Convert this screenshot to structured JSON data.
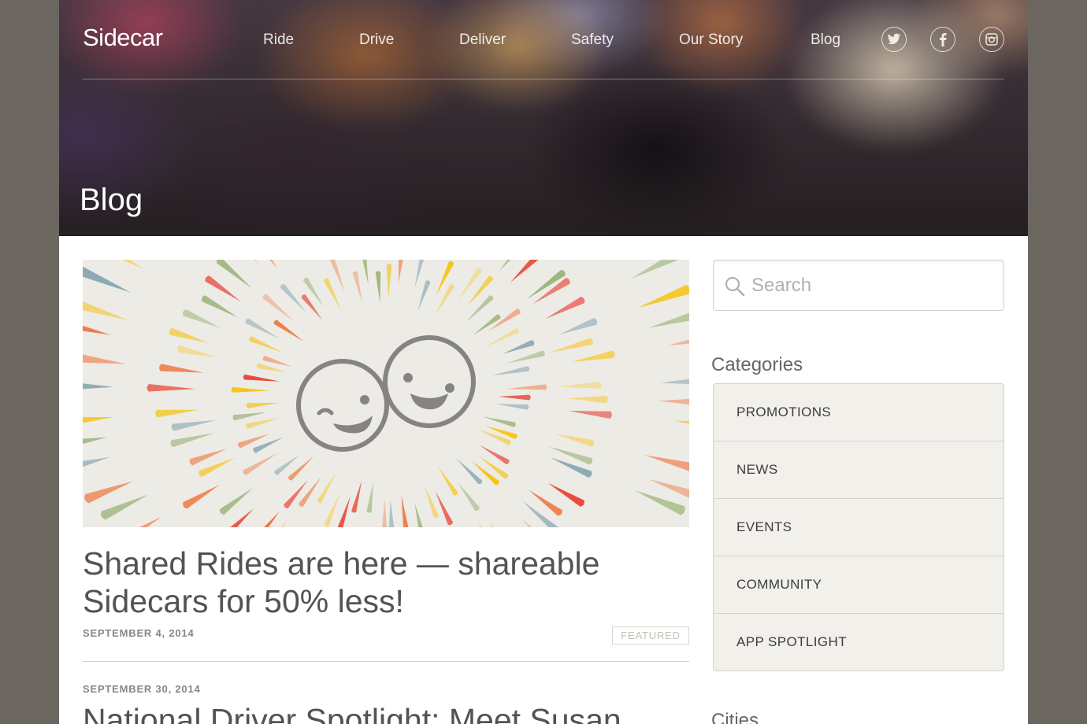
{
  "brand": {
    "logo": "Sidecar"
  },
  "nav": {
    "items": [
      {
        "label": "Ride"
      },
      {
        "label": "Drive"
      },
      {
        "label": "Deliver"
      },
      {
        "label": "Safety"
      },
      {
        "label": "Our Story"
      },
      {
        "label": "Blog"
      }
    ],
    "social": [
      "twitter-icon",
      "facebook-icon",
      "instagram-icon"
    ]
  },
  "hero": {
    "title": "Blog"
  },
  "featured_post": {
    "title": "Shared Rides are here — shareable Sidecars for 50% less!",
    "date": "SEPTEMBER 4, 2014",
    "badge": "FEATURED"
  },
  "second_post": {
    "date": "SEPTEMBER 30, 2014",
    "title": "National Driver Spotlight: Meet Susan"
  },
  "sidebar": {
    "search": {
      "placeholder": "Search",
      "value": ""
    },
    "categories_heading": "Categories",
    "categories": [
      {
        "label": "PROMOTIONS"
      },
      {
        "label": "NEWS"
      },
      {
        "label": "EVENTS"
      },
      {
        "label": "COMMUNITY"
      },
      {
        "label": "APP SPOTLIGHT"
      }
    ],
    "cities_heading": "Cities"
  },
  "colors": {
    "page_bg": "#6b6760",
    "text": "#555250",
    "category_bg": "#f1f0eb",
    "burst": [
      "#f5c518",
      "#e8392a",
      "#f0733a",
      "#9db57c",
      "#8ca9b3",
      "#eea98a",
      "#f3d36b"
    ]
  }
}
